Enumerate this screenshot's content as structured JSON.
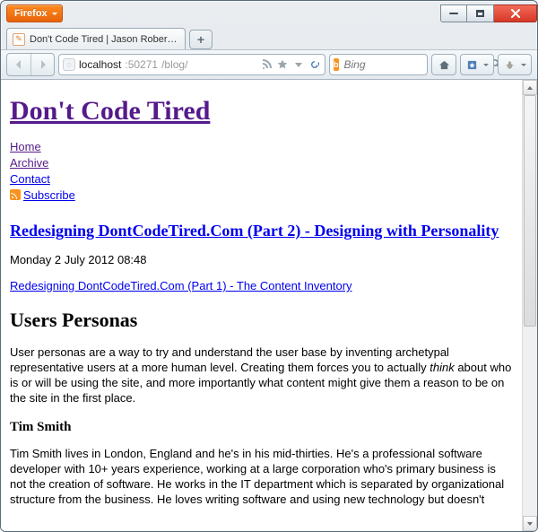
{
  "window": {
    "app_label": "Firefox",
    "tab_title": "Don't Code Tired | Jason Roberts on Soft...",
    "new_tab_symbol": "+"
  },
  "address": {
    "host": "localhost",
    "port": ":50271",
    "path": "/blog/"
  },
  "search": {
    "engine_letter": "b",
    "placeholder": "Bing"
  },
  "site": {
    "title": "Don't Code Tired",
    "nav": {
      "home": "Home",
      "archive": "Archive",
      "contact": "Contact",
      "subscribe": "Subscribe"
    }
  },
  "post": {
    "title": "Redesigning DontCodeTired.Com (Part 2) - Designing with Personality",
    "date": "Monday 2 July 2012 08:48",
    "prev_link": "Redesigning DontCodeTired.Com (Part 1) - The Content Inventory",
    "section_heading": "Users Personas",
    "p1_a": "User personas are a way to try and understand the user base by inventing archetypal representative users at a more human level. Creating them forces you to actually ",
    "p1_em": "think",
    "p1_b": " about who is or will be using the site, and more importantly what content might give them a reason to be on the site in the first place.",
    "persona_heading": "Tim Smith",
    "p2": "Tim Smith lives in London, England and he's in his mid-thirties. He's a professional software developer with 10+ years experience, working at a large corporation who's primary business is not the creation of software. He works in the IT department which is separated by organizational structure from the business. He loves writing software and using new technology but doesn't"
  }
}
